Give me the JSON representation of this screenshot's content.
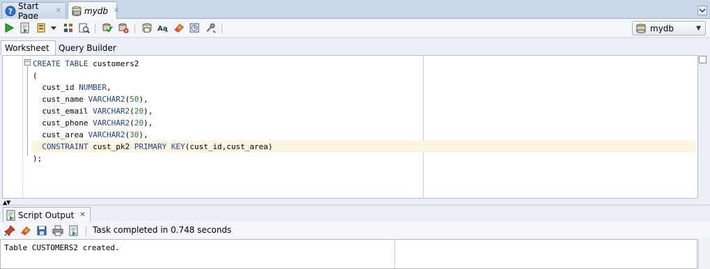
{
  "doc_tabs": [
    {
      "label": "Start Page",
      "icon": "help-icon",
      "close": "✕"
    },
    {
      "label": "mydb",
      "icon": "sql-worksheet-icon",
      "close": "✕"
    }
  ],
  "connection": {
    "selected": "mydb"
  },
  "subtabs": [
    "Worksheet",
    "Query Builder"
  ],
  "editor": {
    "lines": [
      [
        {
          "t": "CREATE TABLE",
          "c": "kw"
        },
        {
          "t": " customers2"
        }
      ],
      [
        {
          "t": "("
        }
      ],
      [
        {
          "t": "  cust_id "
        },
        {
          "t": "NUMBER",
          "c": "kw"
        },
        {
          "t": ","
        }
      ],
      [
        {
          "t": "  cust_name "
        },
        {
          "t": "VARCHAR2",
          "c": "kw"
        },
        {
          "t": "("
        },
        {
          "t": "50",
          "c": "num"
        },
        {
          "t": "),"
        }
      ],
      [
        {
          "t": "  cust_email "
        },
        {
          "t": "VARCHAR2",
          "c": "kw"
        },
        {
          "t": "("
        },
        {
          "t": "20",
          "c": "num"
        },
        {
          "t": "),"
        }
      ],
      [
        {
          "t": "  cust_phone "
        },
        {
          "t": "VARCHAR2",
          "c": "kw"
        },
        {
          "t": "("
        },
        {
          "t": "20",
          "c": "num"
        },
        {
          "t": "),"
        }
      ],
      [
        {
          "t": "  cust_area "
        },
        {
          "t": "VARCHAR2",
          "c": "kw"
        },
        {
          "t": "("
        },
        {
          "t": "30",
          "c": "num"
        },
        {
          "t": "),"
        }
      ],
      [
        {
          "t": "  "
        },
        {
          "t": "CONSTRAINT",
          "c": "kw"
        },
        {
          "t": " cust_pk2 "
        },
        {
          "t": "PRIMARY KEY",
          "c": "kw"
        },
        {
          "t": "(cust_id,cust_area)"
        }
      ],
      [
        {
          "t": ");"
        }
      ]
    ],
    "highlighted_line": 7
  },
  "output_panel": {
    "tab_label": "Script Output",
    "tab_close": "✕",
    "status": "Task completed in 0.748 seconds",
    "text": "Table CUSTOMERS2 created."
  },
  "colors": {
    "keyword": "#1f3f9a",
    "number": "#2a7a2a",
    "current_line": "#fbf6e1"
  }
}
